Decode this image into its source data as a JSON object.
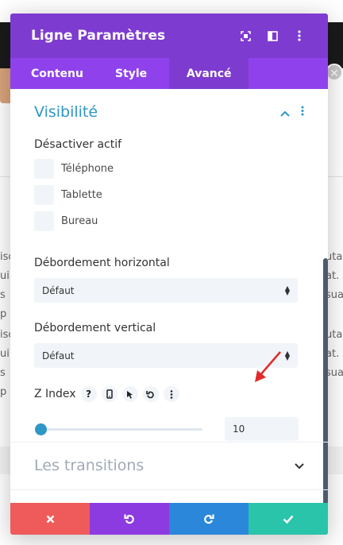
{
  "modal": {
    "title": "Ligne Paramètres",
    "header_icons": [
      "focus-icon",
      "split-view-icon",
      "kebab-menu-icon"
    ]
  },
  "tabs": [
    {
      "label": "Contenu",
      "active": false
    },
    {
      "label": "Style",
      "active": false
    },
    {
      "label": "Avancé",
      "active": true
    }
  ],
  "visibility": {
    "title": "Visibilité",
    "disable_label": "Désactiver actif",
    "options": [
      "Téléphone",
      "Tablette",
      "Bureau"
    ]
  },
  "overflow_h": {
    "label": "Débordement horizontal",
    "value": "Défaut"
  },
  "overflow_v": {
    "label": "Débordement vertical",
    "value": "Défaut"
  },
  "zindex": {
    "label": "Z Index",
    "value": "10",
    "slider_fraction": 0.0
  },
  "transitions": {
    "title": "Les transitions"
  },
  "footer": {
    "buttons": [
      {
        "name": "cancel",
        "color": "#ef5b5b"
      },
      {
        "name": "undo",
        "color": "#8c3be0"
      },
      {
        "name": "redo",
        "color": "#2b87da"
      },
      {
        "name": "save",
        "color": "#29c4a9"
      }
    ]
  },
  "colors": {
    "header": "#7e3bd0",
    "tabs": "#8f42ec",
    "accent": "#2f96c6",
    "arrow": "#e02b2b"
  }
}
